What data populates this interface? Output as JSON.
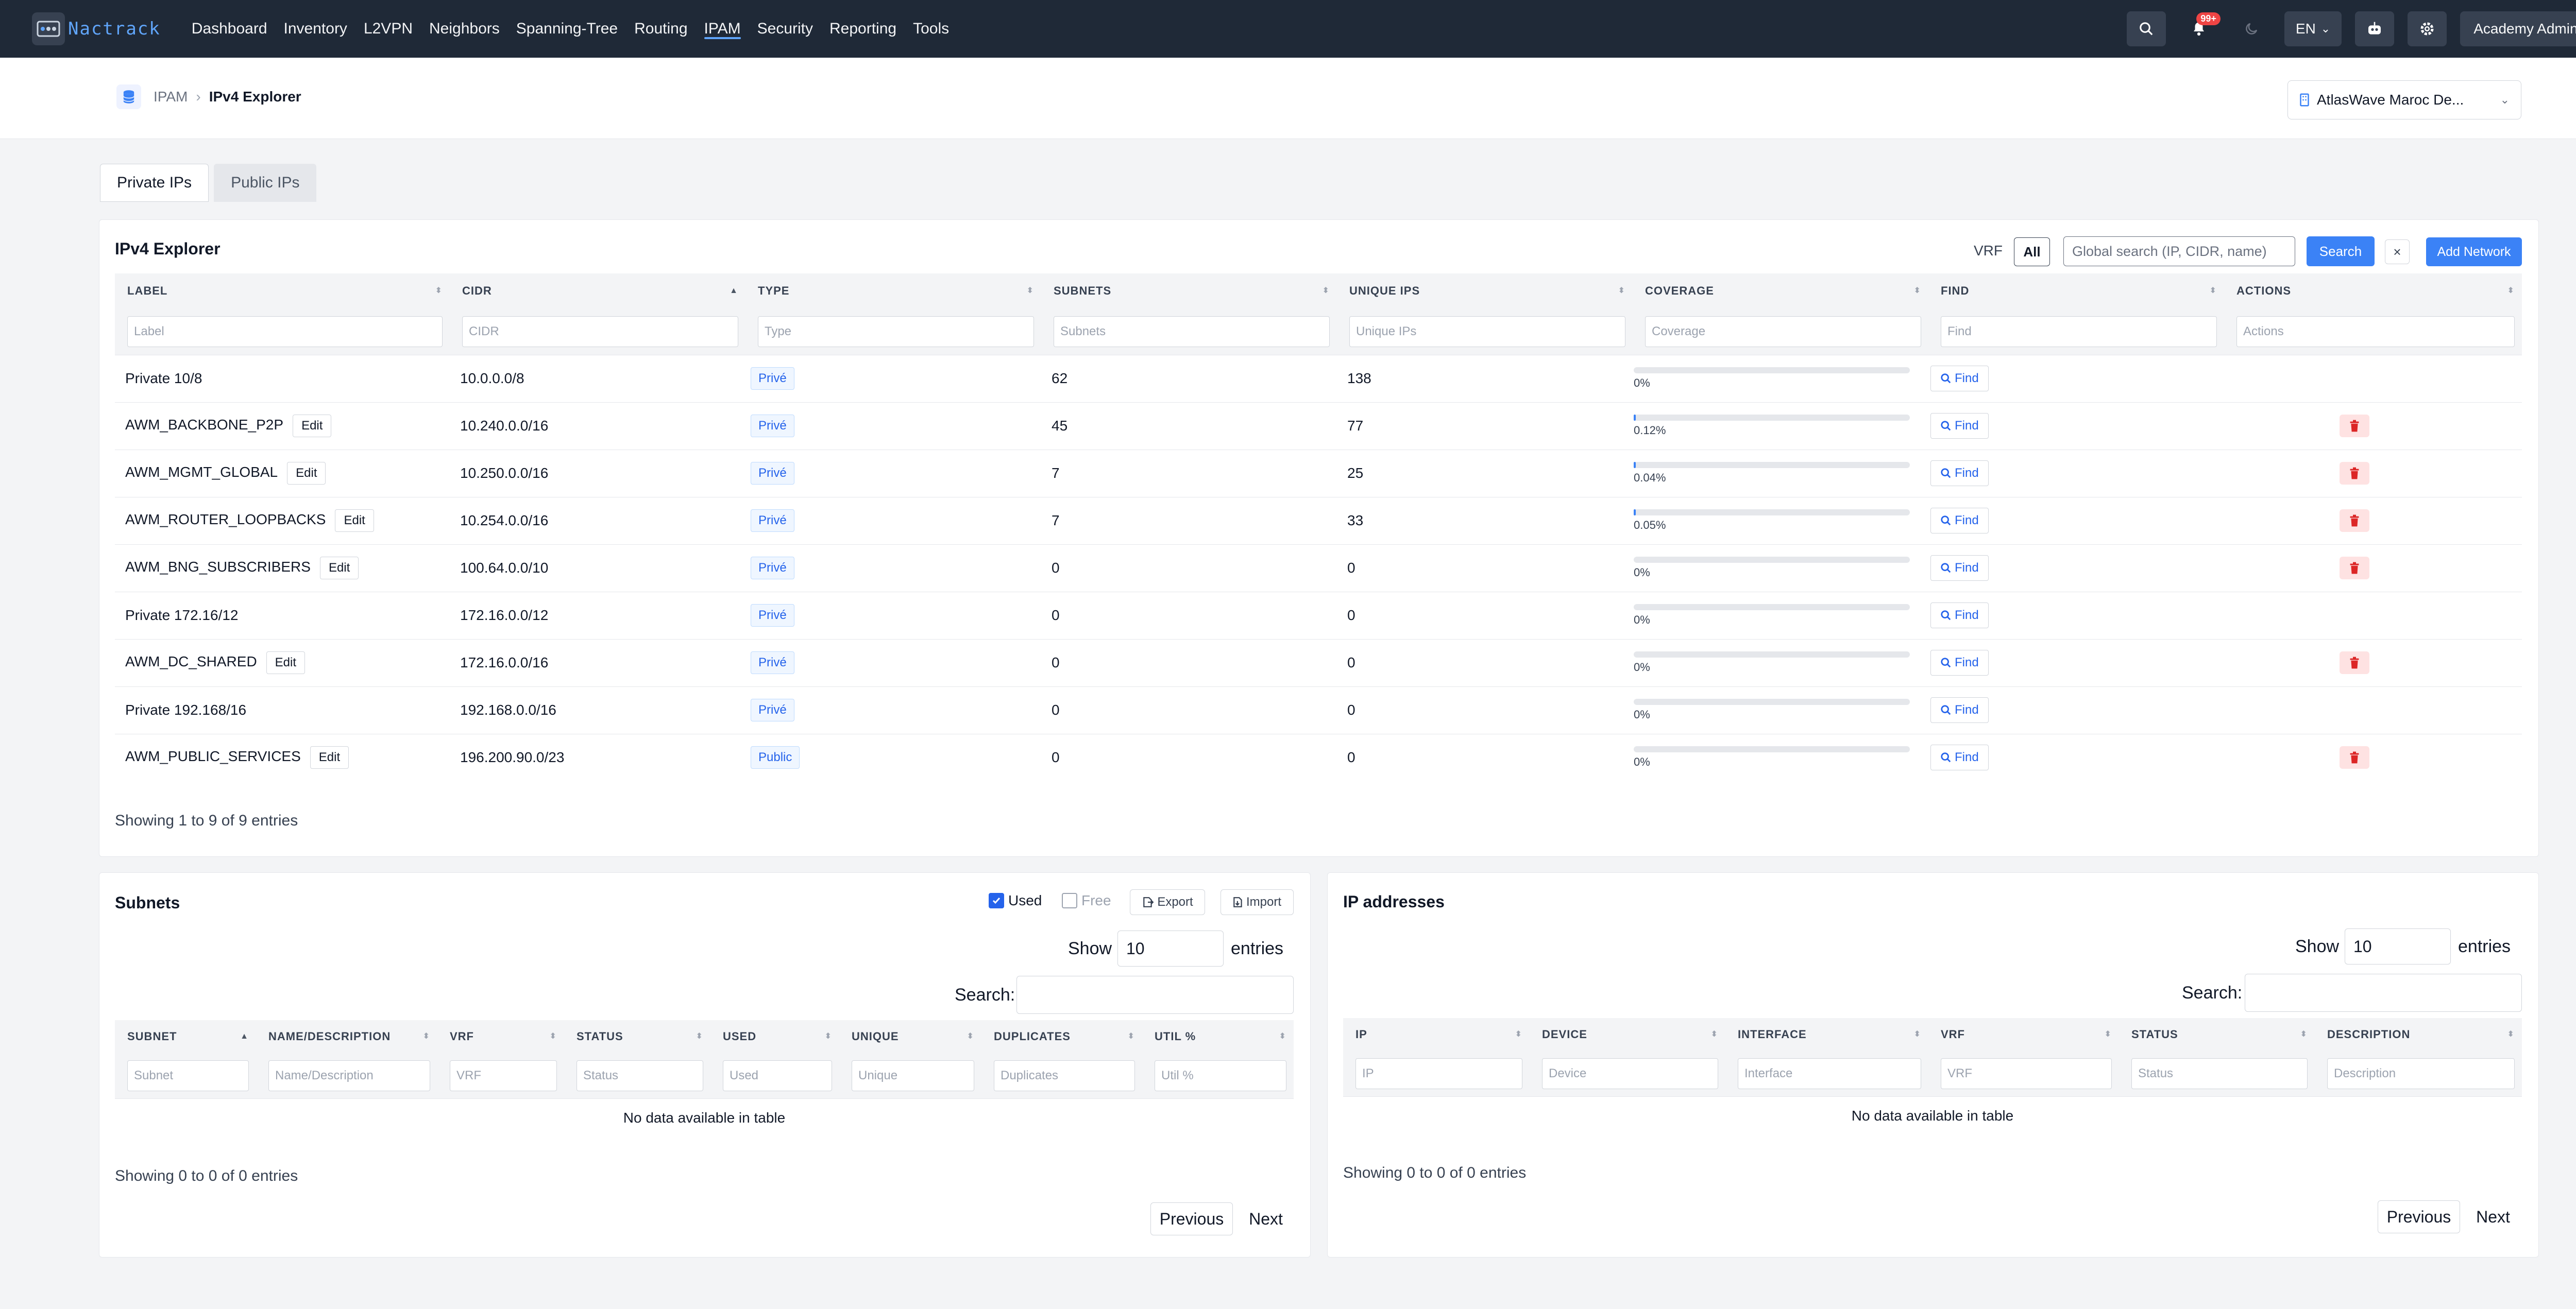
{
  "brand": {
    "name": "Nactrack"
  },
  "nav": {
    "items": [
      "Dashboard",
      "Inventory",
      "L2VPN",
      "Neighbors",
      "Spanning-Tree",
      "Routing",
      "IPAM",
      "Security",
      "Reporting",
      "Tools"
    ],
    "active": "IPAM",
    "notifications_badge": "99+",
    "language": "EN",
    "user": "Academy Admin"
  },
  "breadcrumb": {
    "parent": "IPAM",
    "separator": "›",
    "current": "IPv4 Explorer"
  },
  "site_selector": {
    "value": "AtlasWave Maroc De..."
  },
  "tabs": [
    {
      "label": "Private IPs",
      "active": true
    },
    {
      "label": "Public IPs",
      "active": false
    }
  ],
  "explorer": {
    "title": "IPv4 Explorer",
    "vrf_label": "VRF",
    "vrf_value": "All",
    "search_placeholder": "Global search (IP, CIDR, name)",
    "search_button": "Search",
    "clear_button": "×",
    "add_button": "Add Network",
    "columns": [
      "LABEL",
      "CIDR",
      "TYPE",
      "SUBNETS",
      "UNIQUE IPS",
      "COVERAGE",
      "FIND",
      "ACTIONS"
    ],
    "filters": [
      "Label",
      "CIDR",
      "Type",
      "Subnets",
      "Unique IPs",
      "Coverage",
      "Find",
      "Actions"
    ],
    "edit_label": "Edit",
    "find_label": "Find",
    "rows": [
      {
        "label": "Private 10/8",
        "editable": false,
        "cidr": "10.0.0.0/8",
        "type": "Privé",
        "subnets": "62",
        "unique": "138",
        "coverage": "0%",
        "coverage_pct": 0,
        "deletable": false
      },
      {
        "label": "AWM_BACKBONE_P2P",
        "editable": true,
        "cidr": "10.240.0.0/16",
        "type": "Privé",
        "subnets": "45",
        "unique": "77",
        "coverage": "0.12%",
        "coverage_pct": 0.12,
        "deletable": true
      },
      {
        "label": "AWM_MGMT_GLOBAL",
        "editable": true,
        "cidr": "10.250.0.0/16",
        "type": "Privé",
        "subnets": "7",
        "unique": "25",
        "coverage": "0.04%",
        "coverage_pct": 0.04,
        "deletable": true
      },
      {
        "label": "AWM_ROUTER_LOOPBACKS",
        "editable": true,
        "cidr": "10.254.0.0/16",
        "type": "Privé",
        "subnets": "7",
        "unique": "33",
        "coverage": "0.05%",
        "coverage_pct": 0.05,
        "deletable": true
      },
      {
        "label": "AWM_BNG_SUBSCRIBERS",
        "editable": true,
        "cidr": "100.64.0.0/10",
        "type": "Privé",
        "subnets": "0",
        "unique": "0",
        "coverage": "0%",
        "coverage_pct": 0,
        "deletable": true
      },
      {
        "label": "Private 172.16/12",
        "editable": false,
        "cidr": "172.16.0.0/12",
        "type": "Privé",
        "subnets": "0",
        "unique": "0",
        "coverage": "0%",
        "coverage_pct": 0,
        "deletable": false
      },
      {
        "label": "AWM_DC_SHARED",
        "editable": true,
        "cidr": "172.16.0.0/16",
        "type": "Privé",
        "subnets": "0",
        "unique": "0",
        "coverage": "0%",
        "coverage_pct": 0,
        "deletable": true
      },
      {
        "label": "Private 192.168/16",
        "editable": false,
        "cidr": "192.168.0.0/16",
        "type": "Privé",
        "subnets": "0",
        "unique": "0",
        "coverage": "0%",
        "coverage_pct": 0,
        "deletable": false
      },
      {
        "label": "AWM_PUBLIC_SERVICES",
        "editable": true,
        "cidr": "196.200.90.0/23",
        "type": "Public",
        "subnets": "0",
        "unique": "0",
        "coverage": "0%",
        "coverage_pct": 0,
        "deletable": true
      }
    ],
    "footer": "Showing 1 to 9 of 9 entries"
  },
  "subnets": {
    "title": "Subnets",
    "used_label": "Used",
    "used_checked": true,
    "free_label": "Free",
    "free_checked": false,
    "export_label": "Export",
    "import_label": "Import",
    "show_label": "Show",
    "show_value": "10",
    "entries_label": "entries",
    "search_label": "Search:",
    "columns": [
      "SUBNET",
      "NAME/DESCRIPTION",
      "VRF",
      "STATUS",
      "USED",
      "UNIQUE",
      "DUPLICATES",
      "UTIL %"
    ],
    "filters": [
      "Subnet",
      "Name/Description",
      "VRF",
      "Status",
      "Used",
      "Unique",
      "Duplicates",
      "Util %"
    ],
    "empty": "No data available in table",
    "footer": "Showing 0 to 0 of 0 entries",
    "prev": "Previous",
    "next": "Next"
  },
  "ipaddresses": {
    "title": "IP addresses",
    "show_label": "Show",
    "show_value": "10",
    "entries_label": "entries",
    "search_label": "Search:",
    "columns": [
      "IP",
      "DEVICE",
      "INTERFACE",
      "VRF",
      "STATUS",
      "DESCRIPTION"
    ],
    "filters": [
      "IP",
      "Device",
      "Interface",
      "VRF",
      "Status",
      "Description"
    ],
    "empty": "No data available in table",
    "footer": "Showing 0 to 0 of 0 entries",
    "prev": "Previous",
    "next": "Next"
  },
  "colors": {
    "navbar": "#1f2937",
    "accent": "#3b82f6",
    "link": "#60a5fa",
    "danger": "#ef4444"
  }
}
